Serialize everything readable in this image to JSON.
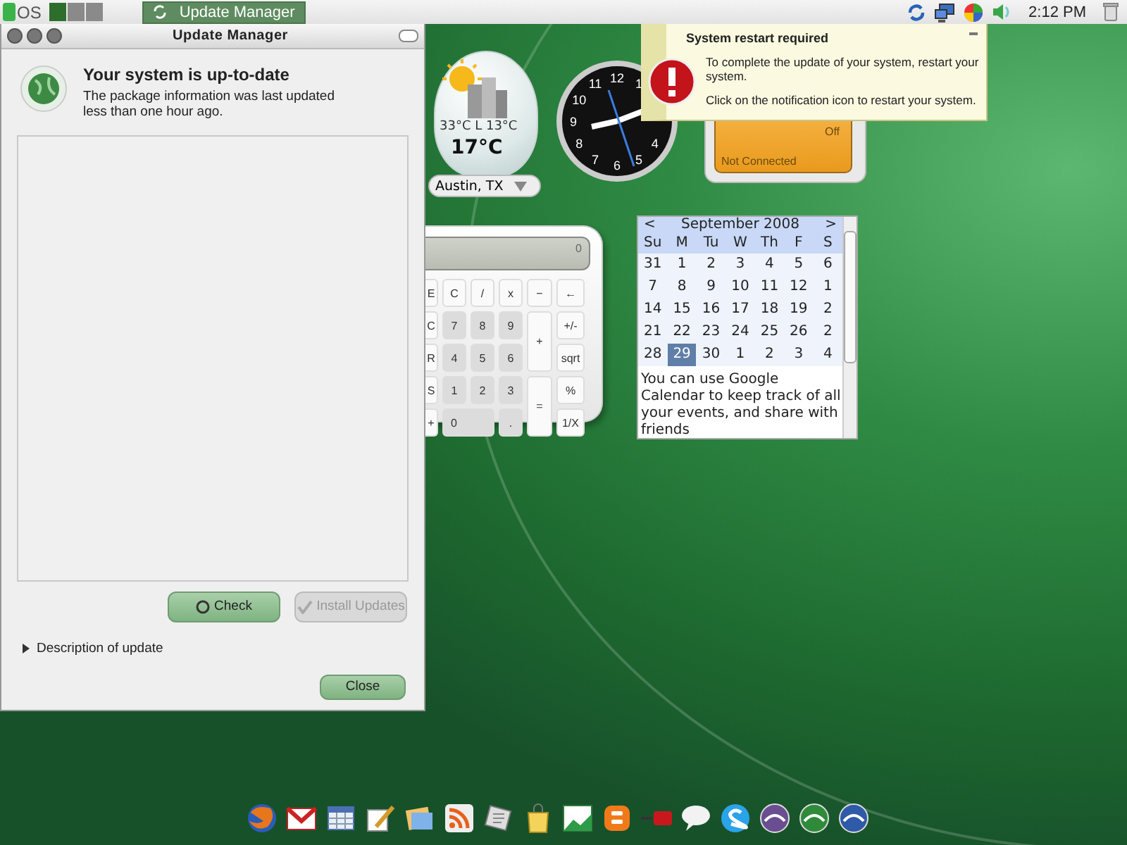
{
  "top_panel": {
    "logo": "OS",
    "tasks": [
      {
        "label": "Update Manager",
        "selected": true
      }
    ],
    "clock": "2:12 PM"
  },
  "update_manager": {
    "title": "Update Manager",
    "heading": "Your system is up-to-date",
    "message": "The package information was last updated less than one hour ago.",
    "buttons": [
      {
        "label": "Check",
        "disabled": false
      },
      {
        "label": "Install Updates",
        "disabled": true
      }
    ],
    "expander": {
      "label": "Description of update",
      "expanded": false
    },
    "close_button": "Close"
  },
  "weather": {
    "range": "33°C L 13°C",
    "temperature": "17°C",
    "location": "Austin, TX"
  },
  "clock_widget": {
    "numerals": [
      "12",
      "11",
      "1",
      "10",
      "9",
      "8",
      "4",
      "7",
      "5",
      "6"
    ]
  },
  "wifi_widget": {
    "switch": "Off",
    "status": "Not Connected"
  },
  "notification": {
    "title": "System restart required",
    "body": "To complete the update of your system, restart your system.",
    "hint": "Click on the notification icon to restart your system."
  },
  "calculator": {
    "display": "0",
    "keys": [
      {
        "label": "E",
        "kind": "edge"
      },
      {
        "label": "C",
        "kind": "key"
      },
      {
        "label": "/",
        "kind": "key"
      },
      {
        "label": "x",
        "kind": "key"
      },
      {
        "label": "−",
        "kind": "key"
      },
      {
        "label": "←",
        "kind": "key"
      },
      {
        "label": "C",
        "kind": "edge"
      },
      {
        "label": "7",
        "kind": "digit"
      },
      {
        "label": "8",
        "kind": "digit"
      },
      {
        "label": "9",
        "kind": "digit"
      },
      {
        "label": "+",
        "kind": "tall"
      },
      {
        "label": "+/-",
        "kind": "key"
      },
      {
        "label": "R",
        "kind": "edge"
      },
      {
        "label": "4",
        "kind": "digit"
      },
      {
        "label": "5",
        "kind": "digit"
      },
      {
        "label": "6",
        "kind": "digit"
      },
      {
        "label": "sqrt",
        "kind": "key"
      },
      {
        "label": "S",
        "kind": "edge"
      },
      {
        "label": "1",
        "kind": "digit"
      },
      {
        "label": "2",
        "kind": "digit"
      },
      {
        "label": "3",
        "kind": "digit"
      },
      {
        "label": "=",
        "kind": "tall"
      },
      {
        "label": "%",
        "kind": "key"
      },
      {
        "label": "+",
        "kind": "edge"
      },
      {
        "label": "0",
        "kind": "wide"
      },
      {
        "label": ".",
        "kind": "digit"
      },
      {
        "label": "1/X",
        "kind": "key"
      }
    ]
  },
  "calendar": {
    "prev": "<",
    "month": "September 2008",
    "next": ">",
    "weekdays": [
      "Su",
      "M",
      "Tu",
      "W",
      "Th",
      "F",
      "S"
    ],
    "days": [
      {
        "label": "31",
        "selected": false
      },
      {
        "label": "1",
        "selected": false
      },
      {
        "label": "2",
        "selected": false
      },
      {
        "label": "3",
        "selected": false
      },
      {
        "label": "4",
        "selected": false
      },
      {
        "label": "5",
        "selected": false
      },
      {
        "label": "6",
        "selected": false
      },
      {
        "label": "7",
        "selected": false
      },
      {
        "label": "8",
        "selected": false
      },
      {
        "label": "9",
        "selected": false
      },
      {
        "label": "10",
        "selected": false
      },
      {
        "label": "11",
        "selected": false
      },
      {
        "label": "12",
        "selected": false
      },
      {
        "label": "1",
        "selected": false
      },
      {
        "label": "14",
        "selected": false
      },
      {
        "label": "15",
        "selected": false
      },
      {
        "label": "16",
        "selected": false
      },
      {
        "label": "17",
        "selected": false
      },
      {
        "label": "18",
        "selected": false
      },
      {
        "label": "19",
        "selected": false
      },
      {
        "label": "2",
        "selected": false
      },
      {
        "label": "21",
        "selected": false
      },
      {
        "label": "22",
        "selected": false
      },
      {
        "label": "23",
        "selected": false
      },
      {
        "label": "24",
        "selected": false
      },
      {
        "label": "25",
        "selected": false
      },
      {
        "label": "26",
        "selected": false
      },
      {
        "label": "2",
        "selected": false
      },
      {
        "label": "28",
        "selected": false
      },
      {
        "label": "29",
        "selected": true
      },
      {
        "label": "30",
        "selected": false
      },
      {
        "label": "1",
        "selected": false
      },
      {
        "label": "2",
        "selected": false
      },
      {
        "label": "3",
        "selected": false
      },
      {
        "label": "4",
        "selected": false
      }
    ],
    "note": "You can use Google Calendar to keep track of all your events, and share with friends"
  }
}
